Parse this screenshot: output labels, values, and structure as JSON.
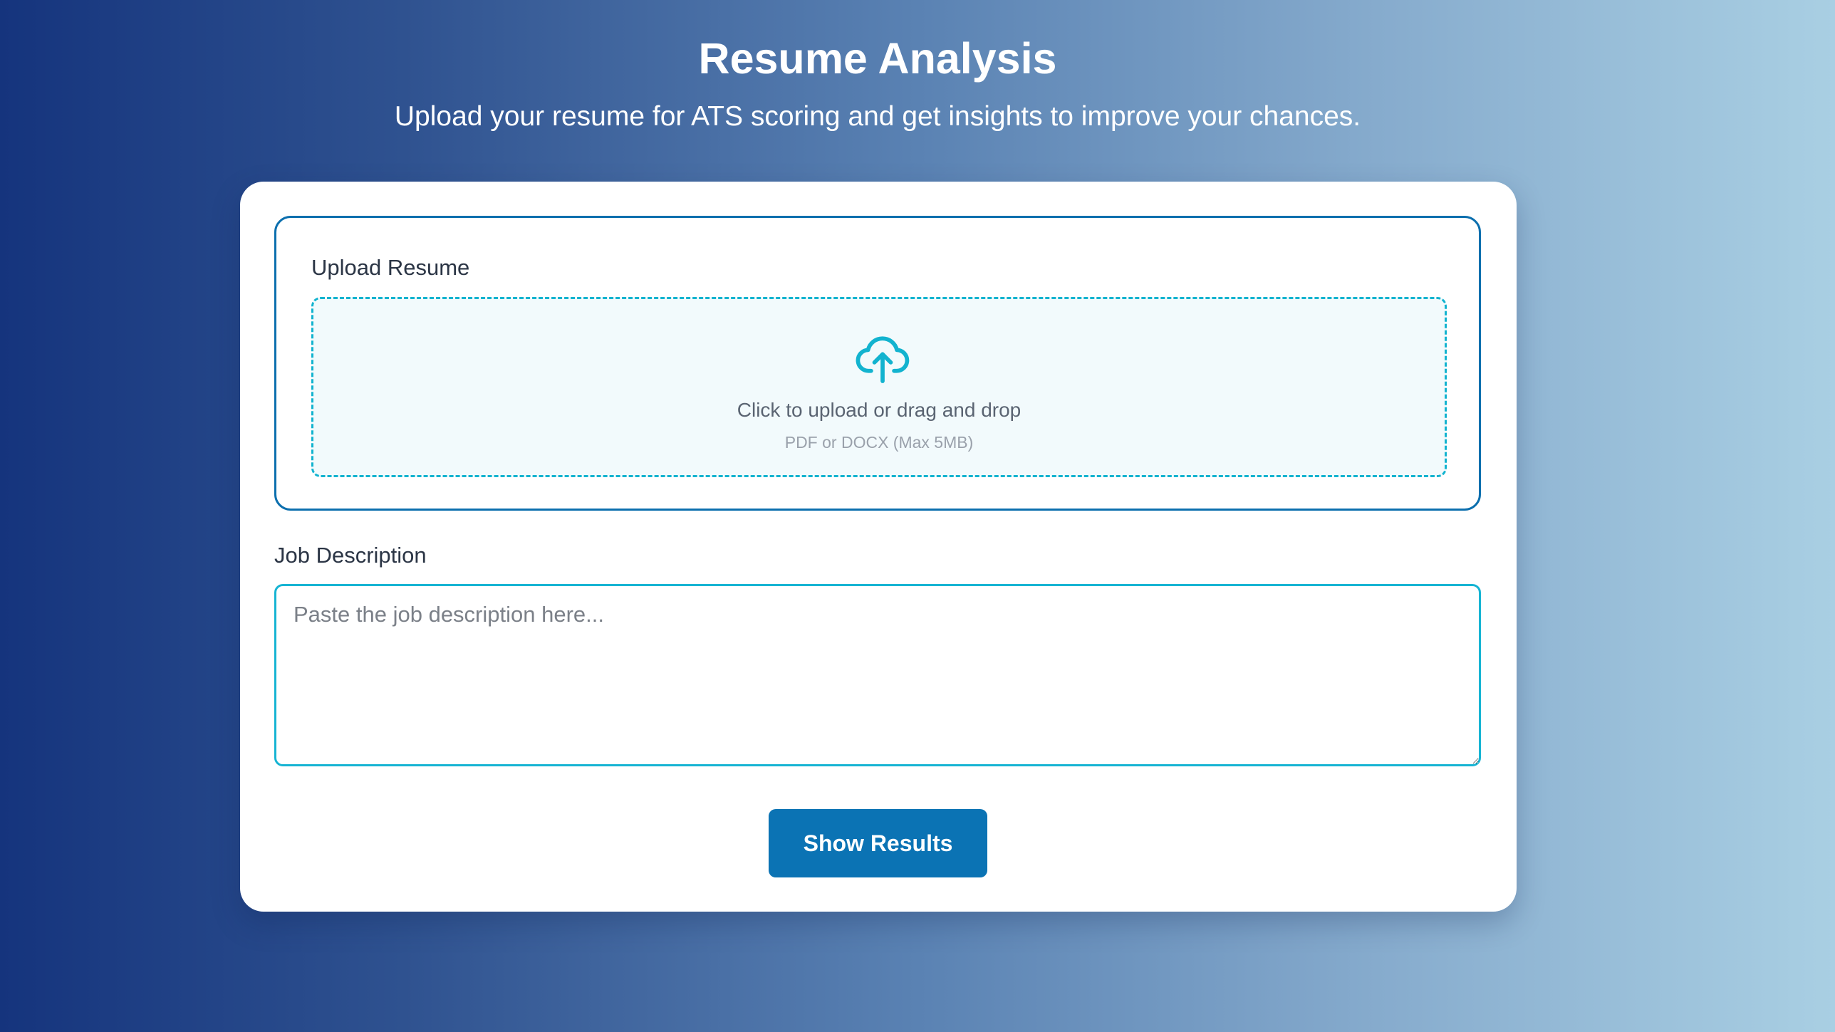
{
  "header": {
    "title": "Resume Analysis",
    "subtitle": "Upload your resume for ATS scoring and get insights to improve your chances."
  },
  "upload": {
    "label": "Upload Resume",
    "icon": "cloud-upload-icon",
    "primary_text": "Click to upload or drag and drop",
    "hint_text": "PDF or DOCX (Max 5MB)"
  },
  "job_description": {
    "label": "Job Description",
    "placeholder": "Paste the job description here...",
    "value": ""
  },
  "actions": {
    "show_results_label": "Show Results"
  },
  "colors": {
    "accent_blue": "#0b73b4",
    "upload_border": "#0c6fae",
    "dropzone_border": "#12b3cf",
    "icon_color": "#12b3cf",
    "textarea_border": "#16b4d3"
  }
}
